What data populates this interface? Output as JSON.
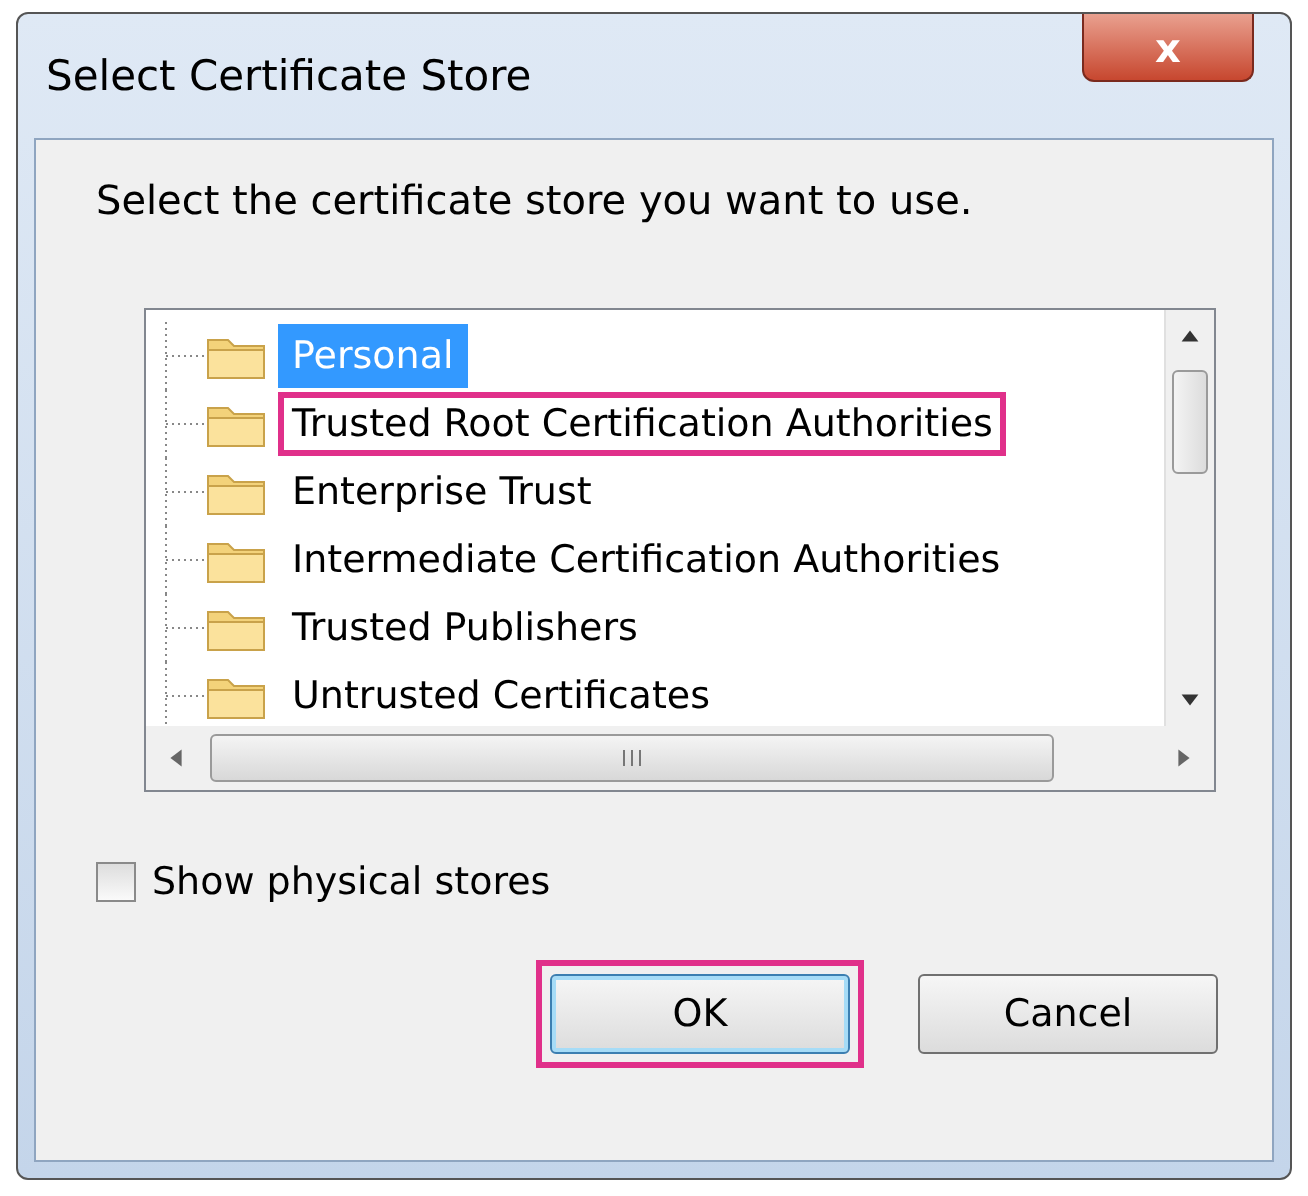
{
  "window": {
    "title": "Select Certificate Store",
    "close_label": "x"
  },
  "instruction": "Select the certificate store you want to use.",
  "stores": [
    {
      "label": "Personal",
      "selected": true,
      "highlighted": false
    },
    {
      "label": "Trusted Root Certification Authorities",
      "selected": false,
      "highlighted": true
    },
    {
      "label": "Enterprise Trust",
      "selected": false,
      "highlighted": false
    },
    {
      "label": "Intermediate Certification Authorities",
      "selected": false,
      "highlighted": false
    },
    {
      "label": "Trusted Publishers",
      "selected": false,
      "highlighted": false
    },
    {
      "label": "Untrusted Certificates",
      "selected": false,
      "highlighted": false
    }
  ],
  "show_physical_stores": {
    "label": "Show physical stores",
    "checked": false
  },
  "buttons": [
    {
      "label": "OK",
      "default": true,
      "highlighted": true
    },
    {
      "label": "Cancel",
      "default": false,
      "highlighted": false
    }
  ]
}
